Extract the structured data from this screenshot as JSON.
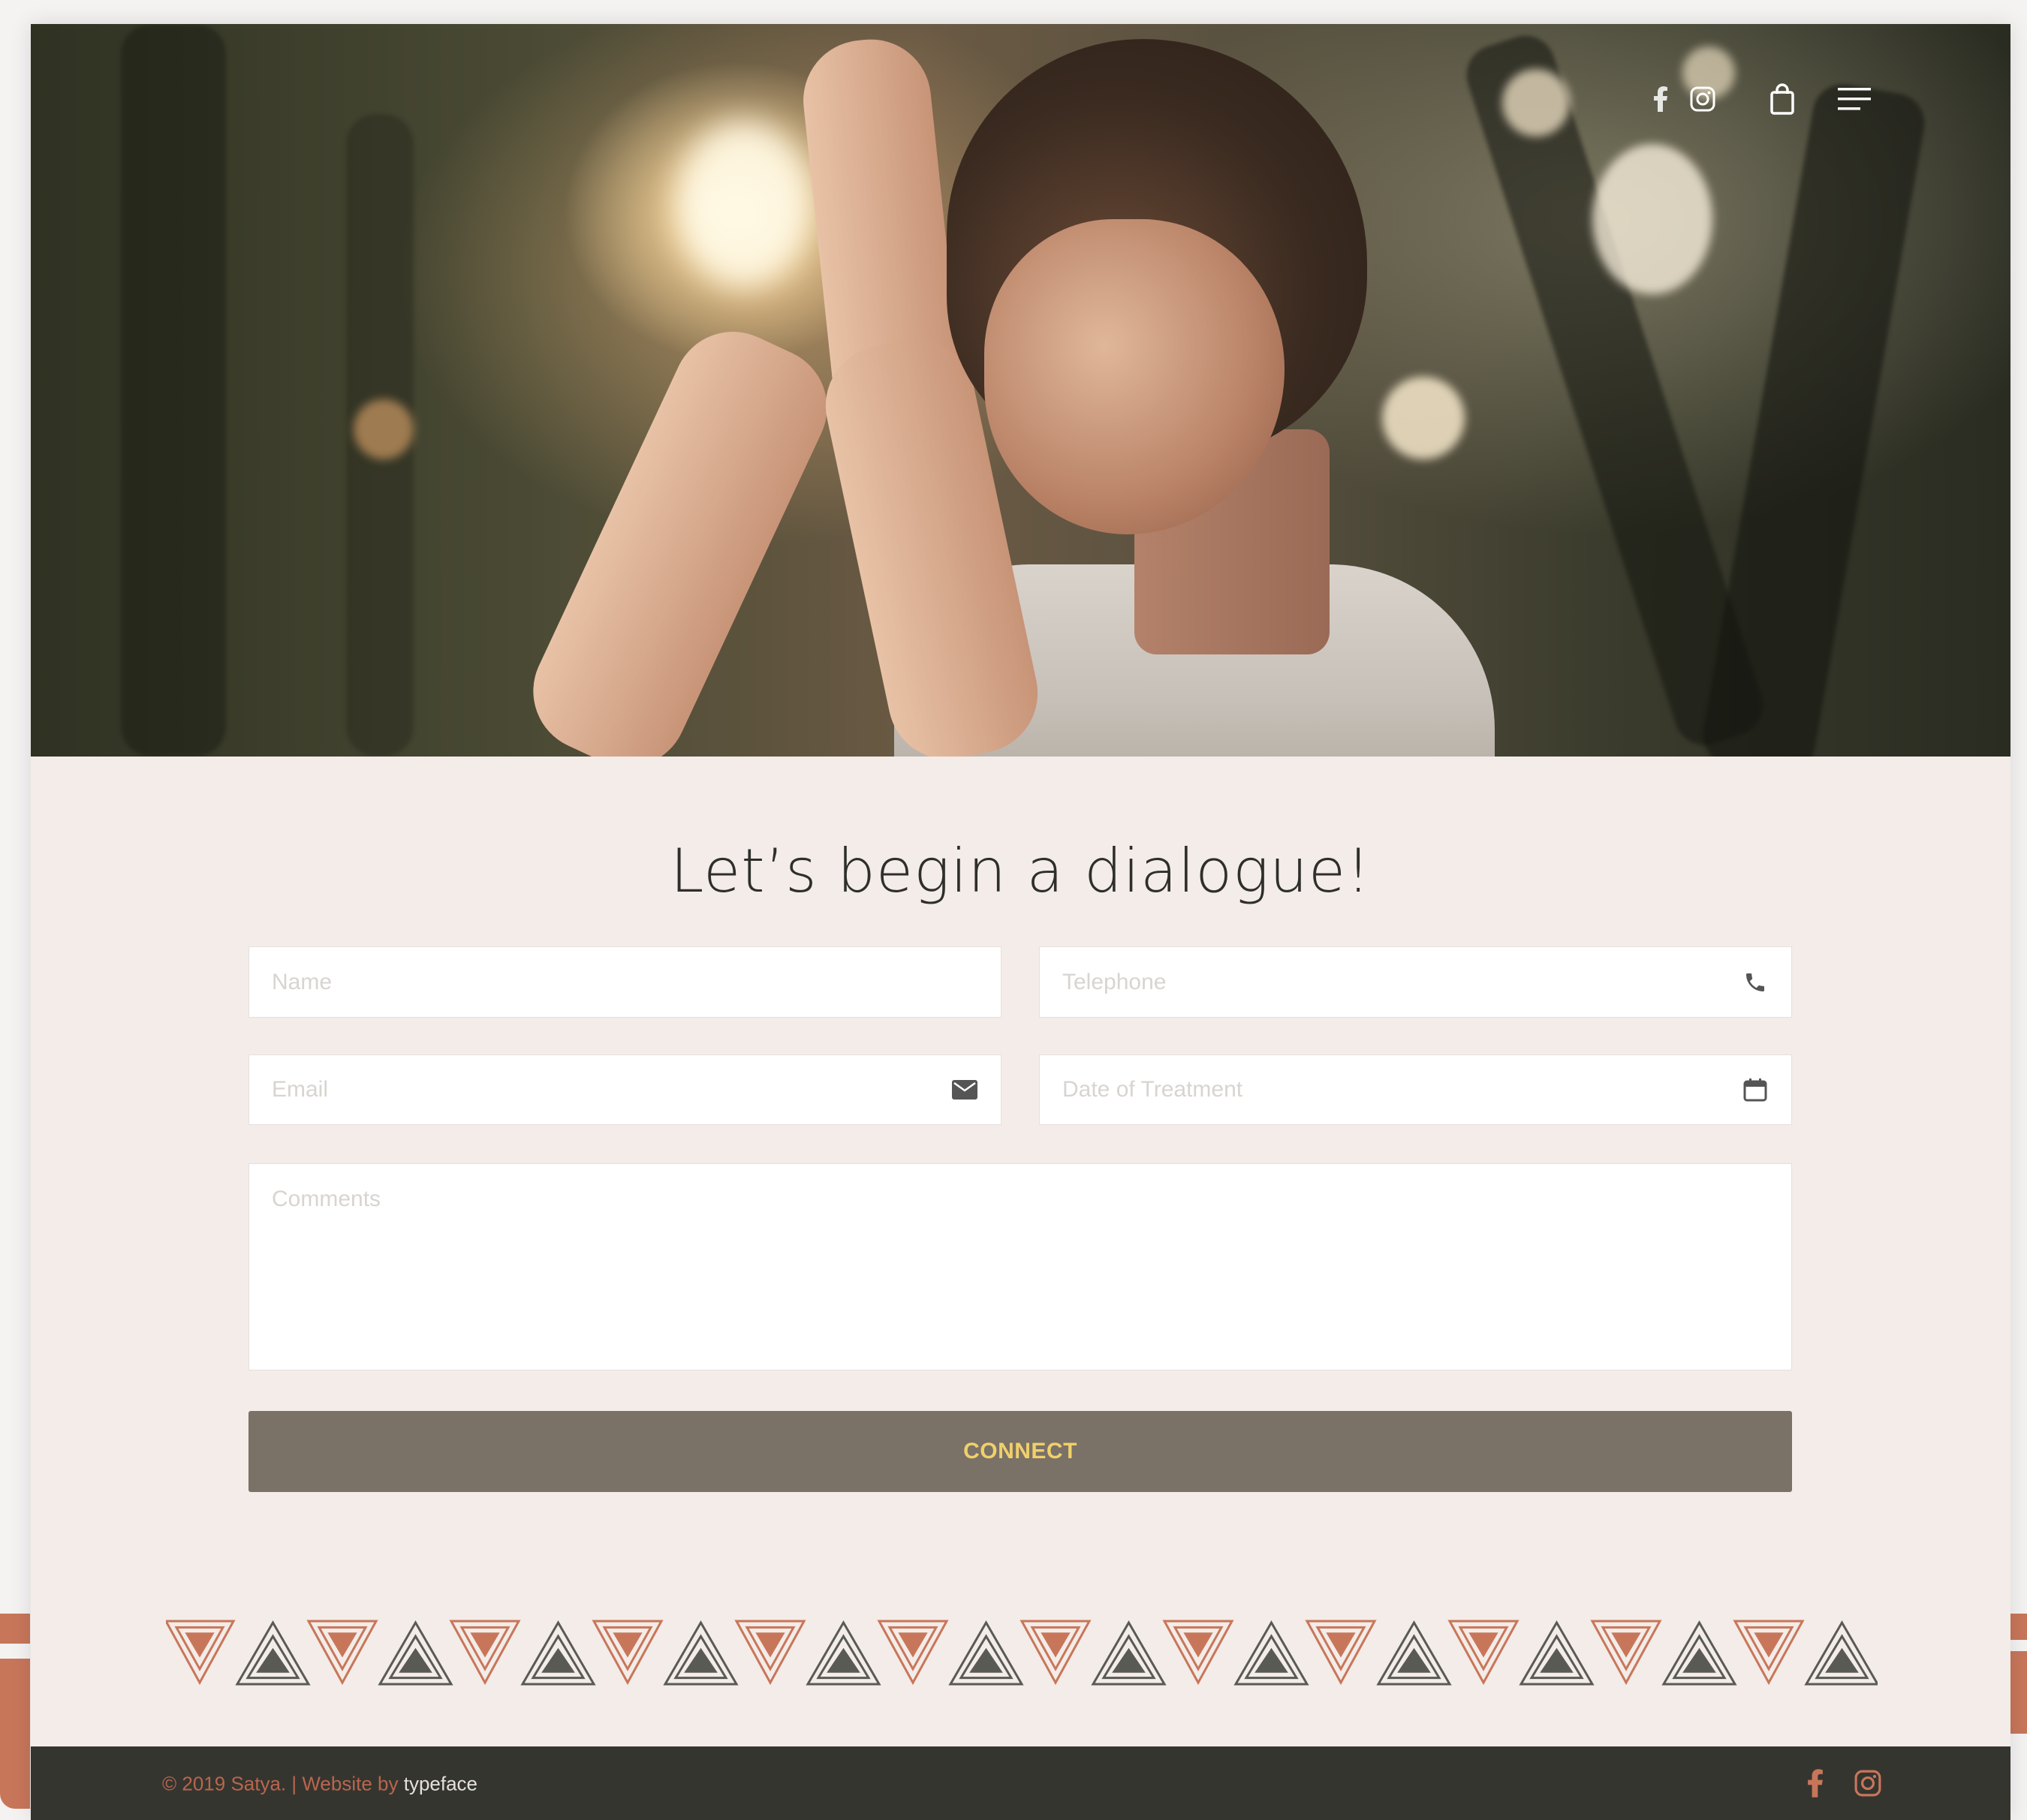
{
  "header": {
    "social": [
      {
        "icon": "facebook-icon"
      },
      {
        "icon": "instagram-icon"
      }
    ],
    "cart_icon": "shopping-bag-icon",
    "menu_icon": "hamburger-menu-icon"
  },
  "hero": {
    "image": "woman-praying-sunlight-photo"
  },
  "contact": {
    "heading": "Let’s begin a dialogue!",
    "fields": {
      "name": {
        "placeholder": "Name"
      },
      "telephone": {
        "placeholder": "Telephone",
        "icon": "phone-icon"
      },
      "email": {
        "placeholder": "Email",
        "icon": "envelope-icon"
      },
      "date": {
        "placeholder": "Date of Treatment",
        "icon": "calendar-icon"
      },
      "comments": {
        "placeholder": "Comments"
      }
    },
    "submit_label": "CONNECT"
  },
  "footer": {
    "copyright": "© 2019 Satya. | Website by",
    "credit": "typeface",
    "social": [
      {
        "icon": "facebook-icon"
      },
      {
        "icon": "instagram-icon"
      }
    ]
  },
  "colors": {
    "accent": "#c8765a",
    "button_bg": "#7a7167",
    "button_text": "#f0d06a",
    "page_bg": "#f3ece8",
    "footer_bg": "#353530"
  }
}
